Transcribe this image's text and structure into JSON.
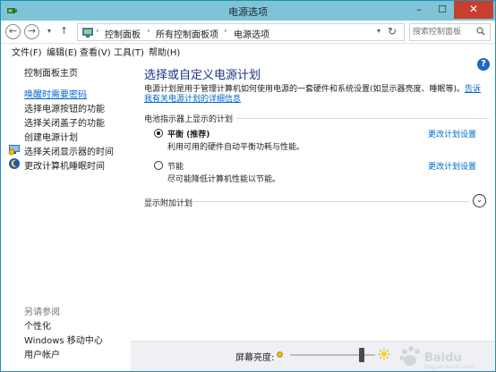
{
  "window": {
    "title": "电源选项",
    "minimize": "–",
    "maximize": "☐",
    "close": "✕"
  },
  "addressbar": {
    "back": "←",
    "forward": "→",
    "history": "▾",
    "up": "↑",
    "breadcrumbs": [
      "控制面板",
      "所有控制面板项",
      "电源选项"
    ],
    "separator": "›",
    "dropdown": "▾",
    "refresh": "↻",
    "search_placeholder": "搜索控制面板"
  },
  "menubar": [
    "文件(F)",
    "编辑(E)",
    "查看(V)",
    "工具(T)",
    "帮助(H)"
  ],
  "sidebar": {
    "home": "控制面板主页",
    "links": [
      "唤醒时需要密码",
      "选择电源按钮的功能",
      "选择关闭盖子的功能",
      "创建电源计划",
      "选择关闭显示器的时间",
      "更改计算机睡眠时间"
    ],
    "see_also_title": "另请参阅",
    "see_also": [
      "个性化",
      "Windows 移动中心",
      "用户帐户"
    ]
  },
  "main": {
    "title": "选择或自定义电源计划",
    "description": "电源计划是用于管理计算机如何使用电源的一套硬件和系统设置(如显示器亮度、睡眠等)。",
    "description_link": "告诉我有关电源计划的详细信息",
    "section_label": "电池指示器上显示的计划",
    "plans": [
      {
        "name": "平衡 (推荐)",
        "desc": "利用可用的硬件自动平衡功耗与性能。",
        "link": "更改计划设置",
        "selected": true
      },
      {
        "name": "节能",
        "desc": "尽可能降低计算机性能以节能。",
        "link": "更改计划设置",
        "selected": false
      }
    ],
    "show_more": "显示附加计划"
  },
  "bottom": {
    "brightness_label": "屏幕亮度:",
    "brightness_level": 0.87
  },
  "icons": {
    "help": "?",
    "expand": "⌄"
  }
}
